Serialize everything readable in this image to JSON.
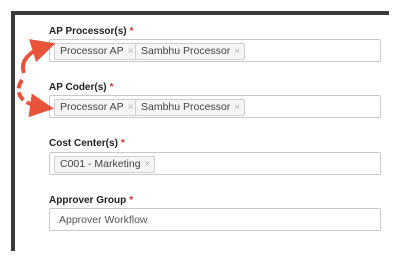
{
  "form": {
    "ap_processors": {
      "label": "AP Processor(s)",
      "required_mark": "*",
      "tags": [
        "Processor AP",
        "Sambhu Processor"
      ]
    },
    "ap_coders": {
      "label": "AP Coder(s)",
      "required_mark": "*",
      "tags": [
        "Processor AP",
        "Sambhu Processor"
      ]
    },
    "cost_centers": {
      "label": "Cost Center(s)",
      "required_mark": "*",
      "tags": [
        "C001 - Marketing"
      ]
    },
    "approver_group": {
      "label": "Approver Group",
      "required_mark": "*",
      "value": "Approver Workflow"
    },
    "tag_remove_symbol": "×"
  },
  "annotation": {
    "arrow_color": "#e8533a"
  }
}
